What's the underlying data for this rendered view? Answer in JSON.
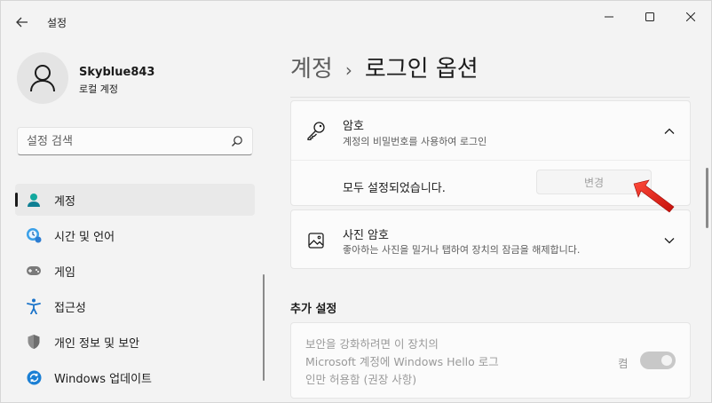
{
  "window": {
    "app_title": "설정",
    "back_icon": "back-arrow-icon",
    "controls": [
      "minimize-icon",
      "maximize-icon",
      "close-icon"
    ]
  },
  "account": {
    "name": "Skyblue843",
    "type": "로컬 계정"
  },
  "search": {
    "placeholder": "설정 검색"
  },
  "sidebar": {
    "items": [
      {
        "label": "계정",
        "icon": "account-icon",
        "active": true
      },
      {
        "label": "시간 및 언어",
        "icon": "time-language-icon",
        "active": false
      },
      {
        "label": "게임",
        "icon": "gaming-icon",
        "active": false
      },
      {
        "label": "접근성",
        "icon": "accessibility-icon",
        "active": false
      },
      {
        "label": "개인 정보 및 보안",
        "icon": "shield-icon",
        "active": false
      },
      {
        "label": "Windows 업데이트",
        "icon": "update-icon",
        "active": false
      }
    ]
  },
  "breadcrumb": {
    "parent": "계정",
    "separator": "›",
    "current": "로그인 옵션"
  },
  "password": {
    "title": "암호",
    "subtitle": "계정의 비밀번호를 사용하여 로그인",
    "status": "모두 설정되었습니다.",
    "change_label": "변경",
    "expanded": true
  },
  "picture_password": {
    "title": "사진 암호",
    "subtitle": "좋아하는 사진을 밀거나 탭하여 장치의 잠금을 해제합니다."
  },
  "additional": {
    "section_title": "추가 설정",
    "hello_line1": "보안을 강화하려면 이 장치의",
    "hello_line2": "Microsoft 계정에 Windows Hello 로그",
    "hello_line3": "인만 허용함 (권장 사항)",
    "toggle_label": "켬",
    "toggle_on": true,
    "disabled": true
  },
  "colors": {
    "background": "#f3f3f3",
    "card": "#fbfbfb",
    "accent": "#0067c0",
    "annotation_arrow": "#e0201b"
  }
}
